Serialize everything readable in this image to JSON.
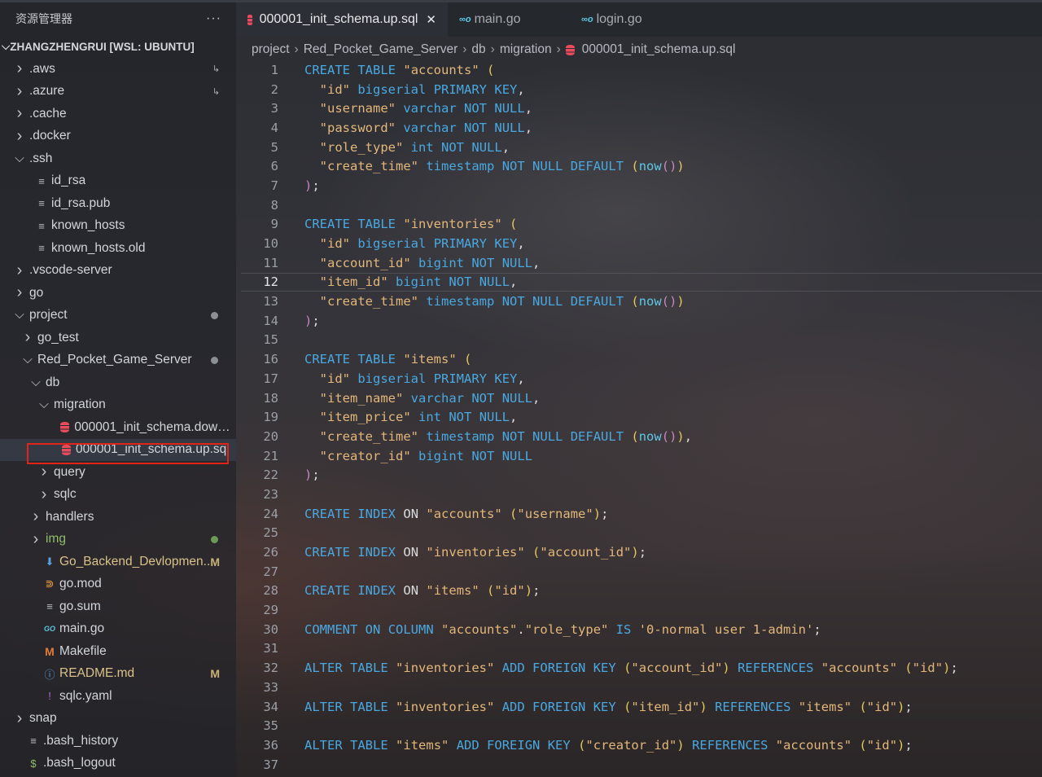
{
  "sidebar": {
    "header": "资源管理器",
    "more": "···",
    "root": "ZHANGZHENGRUI [WSL: UBUNTU]",
    "items": [
      {
        "label": ".aws",
        "indent": 0,
        "kind": "folder",
        "expanded": false,
        "arrow": true
      },
      {
        "label": ".azure",
        "indent": 0,
        "kind": "folder",
        "expanded": false,
        "arrow": true
      },
      {
        "label": ".cache",
        "indent": 0,
        "kind": "folder",
        "expanded": false
      },
      {
        "label": ".docker",
        "indent": 0,
        "kind": "folder",
        "expanded": false
      },
      {
        "label": ".ssh",
        "indent": 0,
        "kind": "folder",
        "expanded": true
      },
      {
        "label": "id_rsa",
        "indent": 1,
        "kind": "file"
      },
      {
        "label": "id_rsa.pub",
        "indent": 1,
        "kind": "file"
      },
      {
        "label": "known_hosts",
        "indent": 1,
        "kind": "file"
      },
      {
        "label": "known_hosts.old",
        "indent": 1,
        "kind": "file"
      },
      {
        "label": ".vscode-server",
        "indent": 0,
        "kind": "folder",
        "expanded": false
      },
      {
        "label": "go",
        "indent": 0,
        "kind": "folder",
        "expanded": false
      },
      {
        "label": "project",
        "indent": 0,
        "kind": "folder",
        "expanded": true,
        "dot": "gray"
      },
      {
        "label": "go_test",
        "indent": 1,
        "kind": "folder",
        "expanded": false
      },
      {
        "label": "Red_Pocket_Game_Server",
        "indent": 1,
        "kind": "folder",
        "expanded": true,
        "dot": "gray"
      },
      {
        "label": "db",
        "indent": 2,
        "kind": "folder",
        "expanded": true
      },
      {
        "label": "migration",
        "indent": 3,
        "kind": "folder",
        "expanded": true
      },
      {
        "label": "000001_init_schema.down.sql",
        "indent": 4,
        "kind": "sql"
      },
      {
        "label": "000001_init_schema.up.sql",
        "indent": 4,
        "kind": "sql",
        "selected": true
      },
      {
        "label": "query",
        "indent": 3,
        "kind": "folder",
        "expanded": false
      },
      {
        "label": "sqlc",
        "indent": 3,
        "kind": "folder",
        "expanded": false
      },
      {
        "label": "handlers",
        "indent": 2,
        "kind": "folder",
        "expanded": false
      },
      {
        "label": "img",
        "indent": 2,
        "kind": "folder",
        "expanded": false,
        "dot": "green",
        "color": "green"
      },
      {
        "label": "Go_Backend_Devlopmen...",
        "indent": 2,
        "kind": "download",
        "badge": "M",
        "color": "yellow"
      },
      {
        "label": "go.mod",
        "indent": 2,
        "kind": "rss"
      },
      {
        "label": "go.sum",
        "indent": 2,
        "kind": "file"
      },
      {
        "label": "main.go",
        "indent": 2,
        "kind": "go"
      },
      {
        "label": "Makefile",
        "indent": 2,
        "kind": "make"
      },
      {
        "label": "README.md",
        "indent": 2,
        "kind": "info",
        "badge": "M",
        "color": "yellow"
      },
      {
        "label": "sqlc.yaml",
        "indent": 2,
        "kind": "yaml"
      },
      {
        "label": "snap",
        "indent": 0,
        "kind": "folder",
        "expanded": false
      },
      {
        "label": ".bash_history",
        "indent": 0,
        "kind": "file"
      },
      {
        "label": ".bash_logout",
        "indent": 0,
        "kind": "dollar"
      }
    ]
  },
  "tabs": [
    {
      "label": "000001_init_schema.up.sql",
      "active": true,
      "icon": "database-icon",
      "close": "✕"
    },
    {
      "label": "main.go",
      "active": false,
      "icon": "go-icon"
    },
    {
      "label": "login.go",
      "active": false,
      "icon": "go-icon"
    }
  ],
  "breadcrumb": [
    "project",
    "Red_Pocket_Game_Server",
    "db",
    "migration",
    "000001_init_schema.up.sql"
  ],
  "editor": {
    "current_line": 12,
    "lines": [
      "CREATE TABLE \"accounts\" (",
      "  \"id\" bigserial PRIMARY KEY,",
      "  \"username\" varchar NOT NULL,",
      "  \"password\" varchar NOT NULL,",
      "  \"role_type\" int NOT NULL,",
      "  \"create_time\" timestamp NOT NULL DEFAULT (now())",
      ");",
      "",
      "CREATE TABLE \"inventories\" (",
      "  \"id\" bigserial PRIMARY KEY,",
      "  \"account_id\" bigint NOT NULL,",
      "  \"item_id\" bigint NOT NULL,",
      "  \"create_time\" timestamp NOT NULL DEFAULT (now())",
      ");",
      "",
      "CREATE TABLE \"items\" (",
      "  \"id\" bigserial PRIMARY KEY,",
      "  \"item_name\" varchar NOT NULL,",
      "  \"item_price\" int NOT NULL,",
      "  \"create_time\" timestamp NOT NULL DEFAULT (now()),",
      "  \"creator_id\" bigint NOT NULL",
      ");",
      "",
      "CREATE INDEX ON \"accounts\" (\"username\");",
      "",
      "CREATE INDEX ON \"inventories\" (\"account_id\");",
      "",
      "CREATE INDEX ON \"items\" (\"id\");",
      "",
      "COMMENT ON COLUMN \"accounts\".\"role_type\" IS '0-normal user 1-admin';",
      "",
      "ALTER TABLE \"inventories\" ADD FOREIGN KEY (\"account_id\") REFERENCES \"accounts\" (\"id\");",
      "",
      "ALTER TABLE \"inventories\" ADD FOREIGN KEY (\"item_id\") REFERENCES \"items\" (\"id\");",
      "",
      "ALTER TABLE \"items\" ADD FOREIGN KEY (\"creator_id\") REFERENCES \"accounts\" (\"id\");",
      ""
    ]
  },
  "colors": {
    "keyword": "#4aa8e0",
    "string": "#e3b77a",
    "paren": "#e4c85a",
    "selection_box": "#e2231a"
  }
}
